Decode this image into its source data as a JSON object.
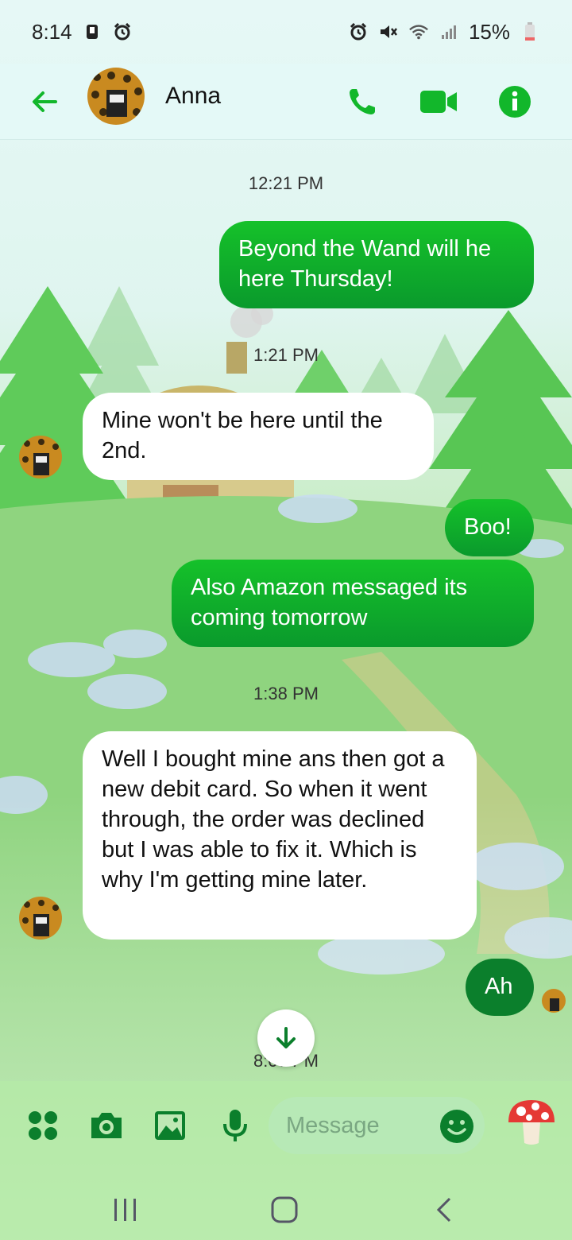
{
  "status_bar": {
    "time": "8:14",
    "battery": "15%",
    "icons_left": [
      "notification-icon",
      "alarm-icon"
    ],
    "icons_right": [
      "alarm-icon",
      "mute-icon",
      "wifi-icon",
      "signal-icon",
      "battery-icon"
    ]
  },
  "header": {
    "contact_name": "Anna",
    "accent": "#12b72b",
    "buttons": [
      "back-arrow-icon",
      "phone-icon",
      "video-icon",
      "info-icon"
    ]
  },
  "conversation": {
    "timestamps": [
      "12:21 PM",
      "1:21 PM",
      "1:38 PM",
      "8:07 PM"
    ],
    "messages": [
      {
        "dir": "out",
        "text": "Beyond the Wand will he here Thursday!"
      },
      {
        "dir": "in",
        "text": "Mine won't be here until the 2nd."
      },
      {
        "dir": "out",
        "text": "Boo!"
      },
      {
        "dir": "out",
        "text": "Also Amazon messaged its coming tomorrow"
      },
      {
        "dir": "in",
        "text": "Well I bought mine ans then got a new debit card. So when it went through,  the order was declined but I was able to fix it. Which is why I'm getting mine later."
      },
      {
        "dir": "out",
        "text": "Ah"
      }
    ]
  },
  "composer": {
    "placeholder": "Message",
    "buttons": [
      "apps-icon",
      "camera-icon",
      "gallery-icon",
      "mic-icon",
      "emoji-icon",
      "mushroom-icon"
    ]
  },
  "colors": {
    "outgoing_bubble": "#12a81f",
    "incoming_bubble": "#ffffff",
    "header_bg": "#e4f9f7"
  }
}
